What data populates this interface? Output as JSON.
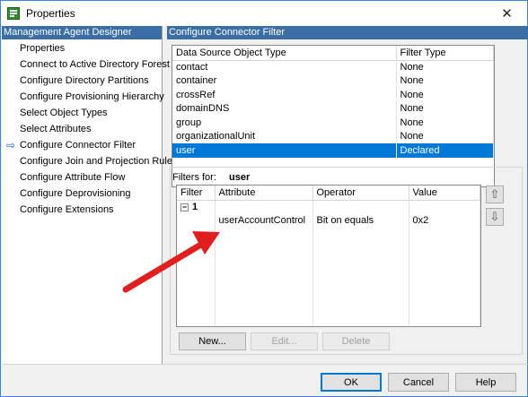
{
  "window": {
    "title": "Properties",
    "close_glyph": "✕"
  },
  "left_pane": {
    "header": "Management Agent Designer",
    "items": [
      {
        "label": "Properties",
        "active": false
      },
      {
        "label": "Connect to Active Directory Forest",
        "active": false
      },
      {
        "label": "Configure Directory Partitions",
        "active": false
      },
      {
        "label": "Configure Provisioning Hierarchy",
        "active": false
      },
      {
        "label": "Select Object Types",
        "active": false
      },
      {
        "label": "Select Attributes",
        "active": false
      },
      {
        "label": "Configure Connector Filter",
        "active": true
      },
      {
        "label": "Configure Join and Projection Rules",
        "active": false
      },
      {
        "label": "Configure Attribute Flow",
        "active": false
      },
      {
        "label": "Configure Deprovisioning",
        "active": false
      },
      {
        "label": "Configure Extensions",
        "active": false
      }
    ],
    "active_arrow": "⇨"
  },
  "right_pane": {
    "header": "Configure Connector Filter",
    "object_table": {
      "columns": [
        "Data Source Object Type",
        "Filter Type"
      ],
      "rows": [
        {
          "type": "contact",
          "filter": "None"
        },
        {
          "type": "container",
          "filter": "None"
        },
        {
          "type": "crossRef",
          "filter": "None"
        },
        {
          "type": "domainDNS",
          "filter": "None"
        },
        {
          "type": "group",
          "filter": "None"
        },
        {
          "type": "organizationalUnit",
          "filter": "None"
        },
        {
          "type": "user",
          "filter": "Declared"
        }
      ],
      "selected_index": 6
    },
    "filters_for_label": "Filters for:",
    "filters_for_value": "user",
    "filter_table": {
      "columns": [
        "Filter",
        "Attribute",
        "Operator",
        "Value"
      ],
      "group_toggle": "−",
      "group_label": "1",
      "rows": [
        {
          "attribute": "userAccountControl",
          "operator": "Bit on equals",
          "value": "0x2"
        }
      ]
    },
    "move_up_glyph": "⇧",
    "move_down_glyph": "⇩",
    "buttons": {
      "new": "New...",
      "edit": "Edit...",
      "delete": "Delete"
    }
  },
  "footer": {
    "ok": "OK",
    "cancel": "Cancel",
    "help": "Help"
  },
  "colors": {
    "pane_header_bg": "#3a6ea5",
    "selection_bg": "#0078d7",
    "annotation_arrow": "#e02020"
  }
}
